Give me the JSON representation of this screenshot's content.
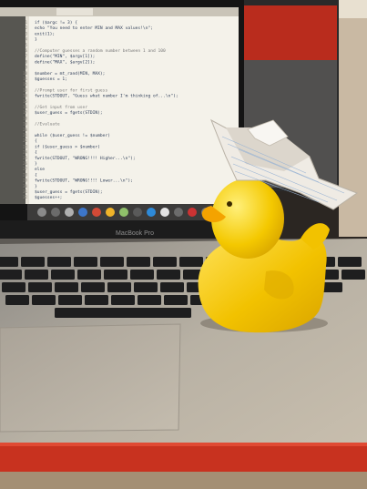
{
  "photo": {
    "laptop_brand": "MacBook Pro",
    "code_lines": [
      "if ($argc != 3) {",
      "    echo \"You need to enter MIN and MAX values!\\n\";",
      "    exit(1);",
      "}",
      "",
      "//Computer guesses a random number between 1 and 100",
      "define(\"MIN\", $argv[1]);",
      "define(\"MAX\", $argv[2]);",
      "",
      "$number = mt_rand(MIN, MAX);",
      "$guesses = 1;",
      "",
      "//Prompt user for first guess",
      "fwrite(STDOUT, \"Guess what number I'm thinking of...\\n\");",
      "",
      "//Get input from user",
      "$user_guess = fgets(STDIN);",
      "",
      "//Evaluate",
      "",
      "while ($user_guess != $number)",
      "{",
      "    if ($user_guess > $number)",
      "    {",
      "        fwrite(STDOUT, \"WRONG!!!! Higher...\\n\");",
      "    }",
      "    else",
      "    {",
      "        fwrite(STDOUT, \"WRONG!!!! Lower...\\n\");",
      "    }",
      "    $user_guess = fgets(STDIN);",
      "    $guesses++;"
    ],
    "colors": {
      "duck": "#f2c200",
      "screen_code_bg": "#f4f2ea",
      "laptop_body": "#b9b2a6",
      "red_case": "#c8321f"
    }
  }
}
